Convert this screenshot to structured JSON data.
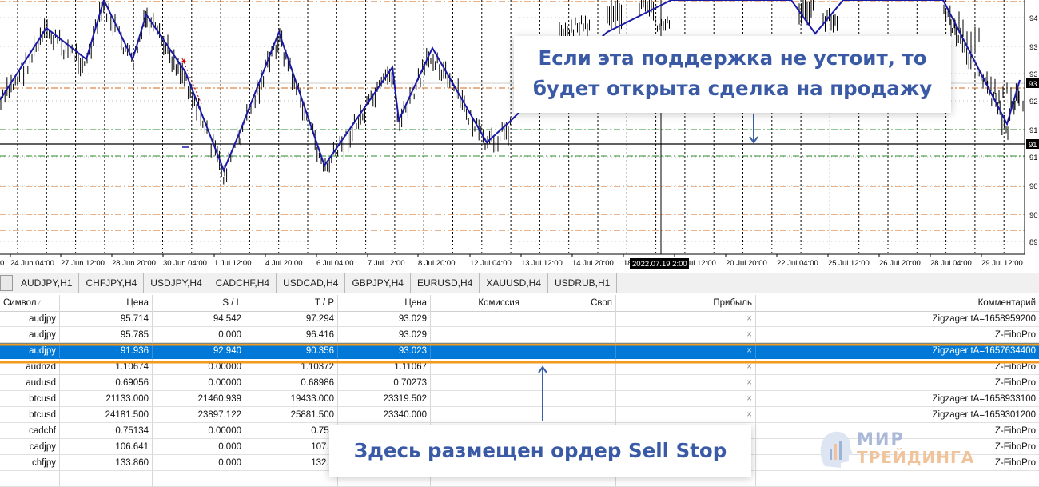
{
  "chart": {
    "price_labels": [
      "94",
      "93",
      "93",
      "92",
      "91",
      "91",
      "90",
      "90",
      "89"
    ],
    "current_price": "93",
    "line_price": "91",
    "dates": [
      "24 Jun 04:00",
      "27 Jun 12:00",
      "28 Jun 20:00",
      "30 Jun 04:00",
      "1 Jul 12:00",
      "4 Jul 20:00",
      "6 Jul 04:00",
      "7 Jul 12:00",
      "8 Jul 20:00",
      "12 Jul 04:00",
      "13 Jul 12:00",
      "14 Jul 20:00",
      "18 Jul 04:00",
      "19 Jul 12:00",
      "20 Jul 20:00",
      "22 Jul 04:00",
      "25 Jul 12:00",
      "26 Jul 20:00",
      "28 Jul 04:00",
      "29 Jul 12:00"
    ],
    "crosshair_date": "2022.07.19 2:00",
    "first_date_fragment": "0",
    "colors": {
      "zigzag": "#1a1aa8",
      "candles": "#000000",
      "grid": "#000000",
      "support": "#000000",
      "green_levels": "#2e8b2e",
      "orange_levels": "#d2691e"
    }
  },
  "tabs": [
    "AUDJPY,H1",
    "CHFJPY,H4",
    "USDJPY,H4",
    "CADCHF,H4",
    "USDCAD,H4",
    "GBPJPY,H4",
    "EURUSD,H4",
    "XAUUSD,H4",
    "USDRUB,H1"
  ],
  "table": {
    "headers": {
      "symbol": "Символ",
      "price": "Цена",
      "sl": "S / L",
      "tp": "T / P",
      "price2": "Цена",
      "commission": "Комиссия",
      "swap": "Своп",
      "profit": "Прибыль",
      "comment": "Комментарий"
    },
    "rows": [
      {
        "symbol": "audjpy",
        "price": "95.714",
        "sl": "94.542",
        "tp": "97.294",
        "price2": "93.029",
        "close": "×",
        "comment": "Zigzager tA=1658959200"
      },
      {
        "symbol": "audjpy",
        "price": "95.785",
        "sl": "0.000",
        "tp": "96.416",
        "price2": "93.029",
        "close": "×",
        "comment": "Z-FiboPro"
      },
      {
        "symbol": "audjpy",
        "price": "91.936",
        "sl": "92.940",
        "tp": "90.356",
        "price2": "93.023",
        "close": "×",
        "comment": "Zigzager tA=1657634400"
      },
      {
        "symbol": "audnzd",
        "price": "1.10674",
        "sl": "0.00000",
        "tp": "1.10372",
        "price2": "1.11067",
        "close": "×",
        "comment": "Z-FiboPro"
      },
      {
        "symbol": "audusd",
        "price": "0.69056",
        "sl": "0.00000",
        "tp": "0.68986",
        "price2": "0.70273",
        "close": "×",
        "comment": "Z-FiboPro"
      },
      {
        "symbol": "btcusd",
        "price": "21133.000",
        "sl": "21460.939",
        "tp": "19433.000",
        "price2": "23319.502",
        "close": "×",
        "comment": "Zigzager tA=1658933100"
      },
      {
        "symbol": "btcusd",
        "price": "24181.500",
        "sl": "23897.122",
        "tp": "25881.500",
        "price2": "23340.000",
        "close": "×",
        "comment": "Zigzager tA=1659301200"
      },
      {
        "symbol": "cadchf",
        "price": "0.75134",
        "sl": "0.00000",
        "tp": "0.754",
        "price2": "",
        "close": "",
        "comment": "Z-FiboPro"
      },
      {
        "symbol": "cadjpy",
        "price": "106.641",
        "sl": "0.000",
        "tp": "107.5",
        "price2": "",
        "close": "",
        "comment": "Z-FiboPro"
      },
      {
        "symbol": "chfjpy",
        "price": "133.860",
        "sl": "0.000",
        "tp": "132.5",
        "price2": "",
        "close": "",
        "comment": "Z-FiboPro"
      },
      {
        "symbol": "",
        "price": "",
        "sl": "",
        "tp": "",
        "price2": "",
        "close": "",
        "comment": ""
      }
    ],
    "selected_index": 2
  },
  "callouts": {
    "top": "Если эта поддержка не устоит, то будет открыта сделка на продажу",
    "bottom": "Здесь размещен ордер Sell Stop"
  },
  "logo": {
    "line1": "МИР",
    "line2": "ТРЕЙДИНГА"
  },
  "highlight_color": "#f29a1f",
  "arrow_color": "#3b5fa8"
}
